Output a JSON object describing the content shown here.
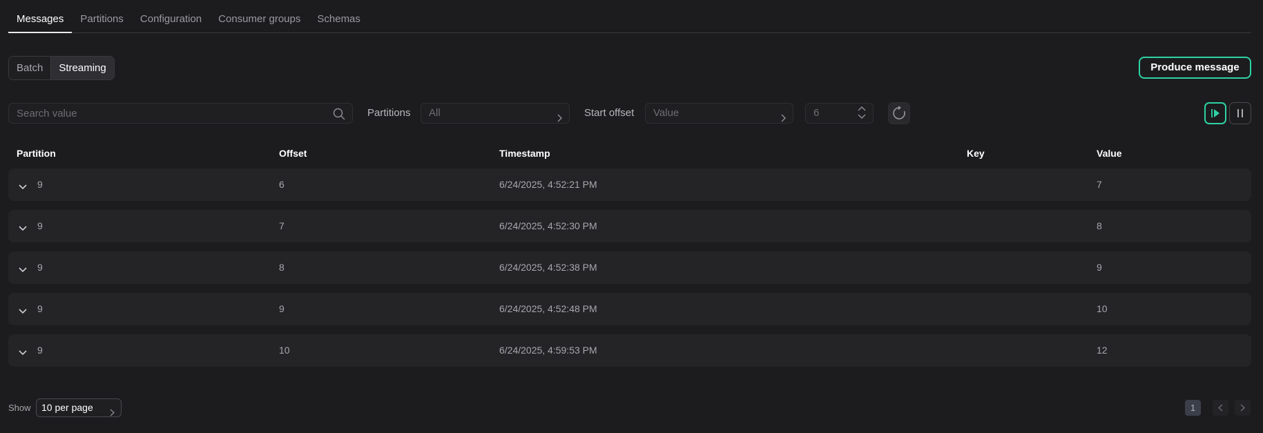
{
  "tabs": [
    {
      "label": "Messages"
    },
    {
      "label": "Partitions"
    },
    {
      "label": "Configuration"
    },
    {
      "label": "Consumer groups"
    },
    {
      "label": "Schemas"
    }
  ],
  "mode": {
    "batch": "Batch",
    "streaming": "Streaming",
    "active": "Streaming"
  },
  "produce_button": "Produce message",
  "filters": {
    "search_placeholder": "Search value",
    "partitions_label": "Partitions",
    "partitions_value": "All",
    "start_offset_label": "Start offset",
    "start_offset_value": "Value",
    "limit_value": "6"
  },
  "table": {
    "columns": [
      "Partition",
      "Offset",
      "Timestamp",
      "Key",
      "Value"
    ],
    "rows": [
      {
        "partition": "9",
        "offset": "6",
        "timestamp": "6/24/2025, 4:52:21 PM",
        "key": "",
        "value": "7"
      },
      {
        "partition": "9",
        "offset": "7",
        "timestamp": "6/24/2025, 4:52:30 PM",
        "key": "",
        "value": "8"
      },
      {
        "partition": "9",
        "offset": "8",
        "timestamp": "6/24/2025, 4:52:38 PM",
        "key": "",
        "value": "9"
      },
      {
        "partition": "9",
        "offset": "9",
        "timestamp": "6/24/2025, 4:52:48 PM",
        "key": "",
        "value": "10"
      },
      {
        "partition": "9",
        "offset": "10",
        "timestamp": "6/24/2025, 4:59:53 PM",
        "key": "",
        "value": "12"
      }
    ]
  },
  "footer": {
    "show_label": "Show",
    "per_page": "10 per page",
    "current_page": "1"
  },
  "colors": {
    "accent": "#2ed3a4",
    "background": "#1c1c1e",
    "row": "#242427"
  }
}
